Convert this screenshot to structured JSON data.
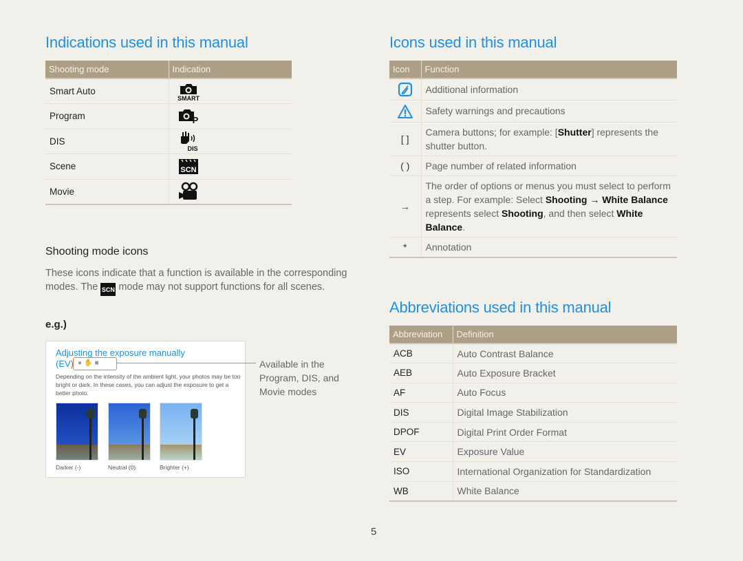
{
  "left": {
    "title": "Indications used in this manual",
    "table": {
      "headers": [
        "Shooting mode",
        "Indication"
      ],
      "rows": [
        {
          "mode": "Smart Auto",
          "icon": "smart-auto-icon",
          "icon_text": "SMART"
        },
        {
          "mode": "Program",
          "icon": "program-icon",
          "icon_text": "P"
        },
        {
          "mode": "DIS",
          "icon": "dis-icon",
          "icon_text": "DIS"
        },
        {
          "mode": "Scene",
          "icon": "scene-icon",
          "icon_text": "SCN"
        },
        {
          "mode": "Movie",
          "icon": "movie-icon",
          "icon_text": ""
        }
      ]
    },
    "subheading": "Shooting mode icons",
    "paragraph_part1": "These icons indicate that a function is available in the corresponding modes. The ",
    "paragraph_icon": "SCN",
    "paragraph_part2": " mode may not support functions for all scenes.",
    "eg_label": "e.g.)",
    "example": {
      "title": "Adjusting the exposure manually",
      "ev_label": "(EV)",
      "description": "Depending on the intensity of the ambient light, your photos may be too bright or dark. In these cases, you can adjust the exposure to get a better photo.",
      "photos": [
        {
          "label": "Darker (-)"
        },
        {
          "label": "Neutral (0)"
        },
        {
          "label": "Brighter (+)"
        }
      ],
      "callout": "Available in the Program, DIS, and Movie modes",
      "accent_color": "#f08030"
    }
  },
  "right": {
    "icons_title": "Icons used in this manual",
    "icons_table": {
      "headers": [
        "Icon",
        "Function"
      ],
      "rows": [
        {
          "symbol": "note-icon",
          "text": "Additional information"
        },
        {
          "symbol": "warning-icon",
          "text": "Safety warnings and precautions"
        },
        {
          "symbol": "[ ]",
          "text_a": "Camera buttons; for example: [",
          "bold_a": "Shutter",
          "text_b": "] represents the shutter button."
        },
        {
          "symbol": "( )",
          "text": "Page number of related information"
        },
        {
          "symbol": "→",
          "text_a": "The order of options or menus you must select to perform a step. For example: Select ",
          "bold_a": "Shooting → White Balance",
          "text_b": " represents select ",
          "bold_b": "Shooting",
          "text_c": ", and then select ",
          "bold_c": "White Balance",
          "text_d": "."
        },
        {
          "symbol": "*",
          "text": "Annotation"
        }
      ]
    },
    "abbr_title": "Abbreviations used in this manual",
    "abbr_table": {
      "headers": [
        "Abbreviation",
        "Definition"
      ],
      "rows": [
        {
          "abbr": "ACB",
          "def": "Auto Contrast Balance"
        },
        {
          "abbr": "AEB",
          "def": "Auto Exposure Bracket"
        },
        {
          "abbr": "AF",
          "def": "Auto Focus"
        },
        {
          "abbr": "DIS",
          "def": "Digital Image Stabilization"
        },
        {
          "abbr": "DPOF",
          "def": "Digital Print Order Format"
        },
        {
          "abbr": "EV",
          "def": "Exposure Value"
        },
        {
          "abbr": "ISO",
          "def": "International Organization for Standardization"
        },
        {
          "abbr": "WB",
          "def": "White Balance"
        }
      ]
    }
  },
  "page_number": "5",
  "colors": {
    "heading_blue": "#1e90e6",
    "table_header": "#ac9f86",
    "background": "#f2f0eb"
  }
}
